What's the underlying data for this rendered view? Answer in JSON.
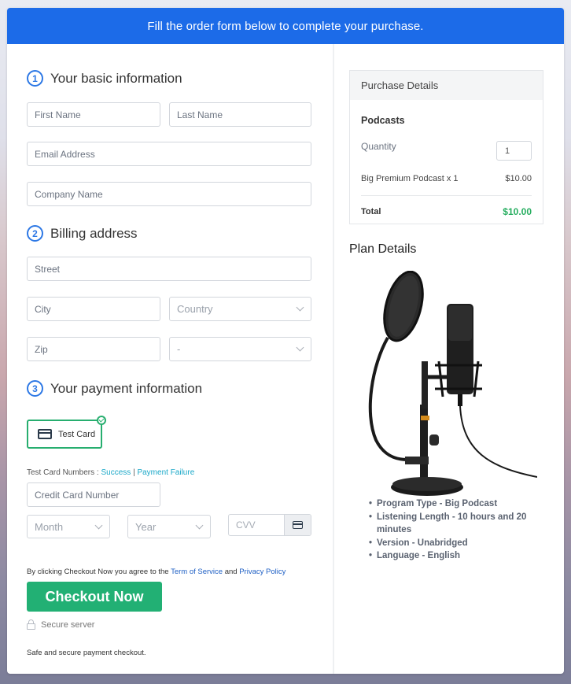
{
  "banner": {
    "text": "Fill the order form below to complete your purchase."
  },
  "sections": {
    "basic": {
      "number": "1",
      "title": "Your basic information"
    },
    "billing": {
      "number": "2",
      "title": "Billing address"
    },
    "payment": {
      "number": "3",
      "title": "Your payment information"
    }
  },
  "fields": {
    "first_name": "First Name",
    "last_name": "Last Name",
    "email": "Email Address",
    "company": "Company Name",
    "street": "Street",
    "city": "City",
    "country": "Country",
    "zip": "Zip",
    "state": "-",
    "card_number": "Credit Card Number",
    "month": "Month",
    "year": "Year",
    "cvv": "CVV"
  },
  "payment": {
    "method_label": "Test Card",
    "test_numbers_label": "Test Card Numbers :",
    "success_link": "Success",
    "separator": "|",
    "failure_link": "Payment Failure"
  },
  "agreement": {
    "prefix": "By clicking Checkout Now you agree to the",
    "terms_link": "Term of Service",
    "and": "and",
    "privacy_link": "Privacy Policy"
  },
  "checkout": {
    "button_label": "Checkout Now",
    "secure_label": "Secure server",
    "safe_note": "Safe and secure payment checkout."
  },
  "purchase": {
    "header": "Purchase Details",
    "product_group": "Podcasts",
    "quantity_label": "Quantity",
    "quantity_value": "1",
    "line_item": "Big Premium Podcast x 1",
    "line_price": "$10.00",
    "total_label": "Total",
    "total_value": "$10.00"
  },
  "plan": {
    "title": "Plan Details",
    "image_alt": "podcast microphone with pop filter and stand",
    "features": [
      "Program Type - Big Podcast",
      "Listening Length - 10 hours and 20 minutes",
      "Version - Unabridged",
      "Language - English"
    ]
  },
  "colors": {
    "banner": "#1c6be8",
    "accent_green": "#22b074",
    "total_green": "#27ae60",
    "step_blue": "#2d78e5"
  }
}
